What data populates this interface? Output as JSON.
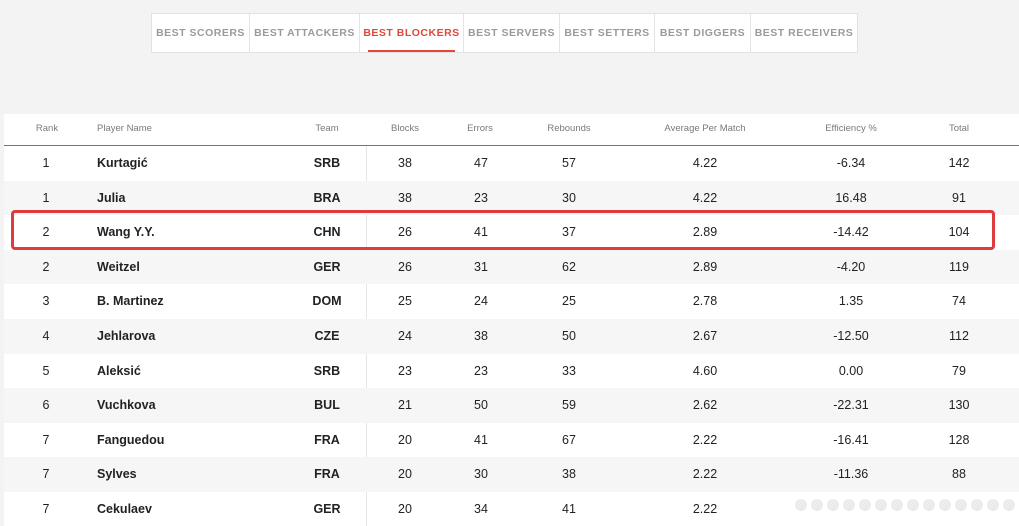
{
  "tabs": [
    {
      "label": "BEST SCORERS",
      "active": false
    },
    {
      "label": "BEST ATTACKERS",
      "active": false
    },
    {
      "label": "BEST BLOCKERS",
      "active": true
    },
    {
      "label": "BEST SERVERS",
      "active": false
    },
    {
      "label": "BEST SETTERS",
      "active": false
    },
    {
      "label": "BEST DIGGERS",
      "active": false
    },
    {
      "label": "BEST RECEIVERS",
      "active": false
    }
  ],
  "colors": {
    "accent": "#e0483a",
    "highlight_border": "#dd3b3d"
  },
  "table": {
    "headers": {
      "rank": "Rank",
      "player": "Player Name",
      "team": "Team",
      "blocks": "Blocks",
      "errors": "Errors",
      "rebounds": "Rebounds",
      "avg": "Average Per Match",
      "efficiency": "Efficiency %",
      "total": "Total"
    },
    "rows": [
      {
        "rank": "1",
        "player": "Kurtagić",
        "team": "SRB",
        "blocks": "38",
        "errors": "47",
        "rebounds": "57",
        "avg": "4.22",
        "efficiency": "-6.34",
        "total": "142"
      },
      {
        "rank": "1",
        "player": "Julia",
        "team": "BRA",
        "blocks": "38",
        "errors": "23",
        "rebounds": "30",
        "avg": "4.22",
        "efficiency": "16.48",
        "total": "91"
      },
      {
        "rank": "2",
        "player": "Wang Y.Y.",
        "team": "CHN",
        "blocks": "26",
        "errors": "41",
        "rebounds": "37",
        "avg": "2.89",
        "efficiency": "-14.42",
        "total": "104",
        "highlighted": true
      },
      {
        "rank": "2",
        "player": "Weitzel",
        "team": "GER",
        "blocks": "26",
        "errors": "31",
        "rebounds": "62",
        "avg": "2.89",
        "efficiency": "-4.20",
        "total": "119"
      },
      {
        "rank": "3",
        "player": "B. Martinez",
        "team": "DOM",
        "blocks": "25",
        "errors": "24",
        "rebounds": "25",
        "avg": "2.78",
        "efficiency": "1.35",
        "total": "74"
      },
      {
        "rank": "4",
        "player": "Jehlarova",
        "team": "CZE",
        "blocks": "24",
        "errors": "38",
        "rebounds": "50",
        "avg": "2.67",
        "efficiency": "-12.50",
        "total": "112"
      },
      {
        "rank": "5",
        "player": "Aleksić",
        "team": "SRB",
        "blocks": "23",
        "errors": "23",
        "rebounds": "33",
        "avg": "4.60",
        "efficiency": "0.00",
        "total": "79"
      },
      {
        "rank": "6",
        "player": "Vuchkova",
        "team": "BUL",
        "blocks": "21",
        "errors": "50",
        "rebounds": "59",
        "avg": "2.62",
        "efficiency": "-22.31",
        "total": "130"
      },
      {
        "rank": "7",
        "player": "Fanguedou",
        "team": "FRA",
        "blocks": "20",
        "errors": "41",
        "rebounds": "67",
        "avg": "2.22",
        "efficiency": "-16.41",
        "total": "128"
      },
      {
        "rank": "7",
        "player": "Sylves",
        "team": "FRA",
        "blocks": "20",
        "errors": "30",
        "rebounds": "38",
        "avg": "2.22",
        "efficiency": "-11.36",
        "total": "88"
      },
      {
        "rank": "7",
        "player": "Cekulaev",
        "team": "GER",
        "blocks": "20",
        "errors": "34",
        "rebounds": "41",
        "avg": "2.22",
        "efficiency": "",
        "total": ""
      }
    ]
  }
}
